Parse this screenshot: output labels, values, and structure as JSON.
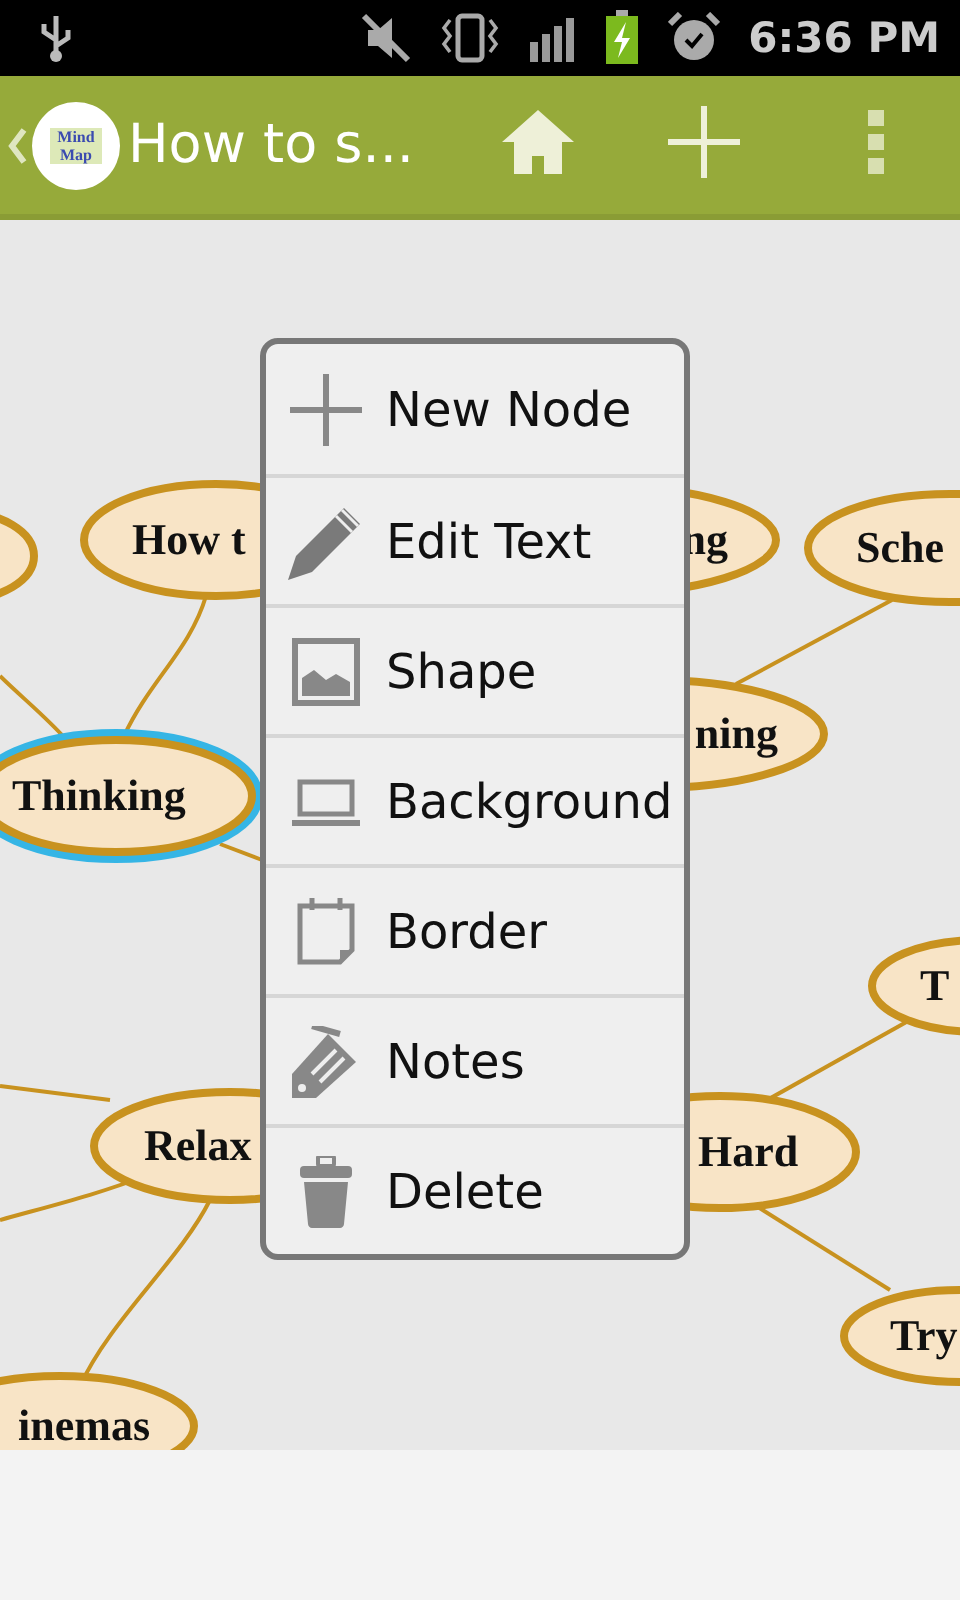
{
  "status_bar": {
    "time": "6:36 PM"
  },
  "action_bar": {
    "logo_text": "Mind Map",
    "title": "How to s..."
  },
  "mind_map": {
    "nodes": [
      {
        "text": "How t",
        "selected": false
      },
      {
        "text": "ng",
        "selected": false
      },
      {
        "text": "Sche",
        "selected": false
      },
      {
        "text": "ning",
        "selected": false
      },
      {
        "text": "Thinking",
        "selected": true
      },
      {
        "text": "T",
        "selected": false
      },
      {
        "text": "Relax",
        "selected": false
      },
      {
        "text": "Hard",
        "selected": false
      },
      {
        "text": "Try",
        "selected": false
      },
      {
        "text": "inemas",
        "selected": false
      }
    ]
  },
  "context_menu": {
    "items": [
      {
        "label": "New Node"
      },
      {
        "label": "Edit Text"
      },
      {
        "label": "Shape"
      },
      {
        "label": "Background"
      },
      {
        "label": "Border"
      },
      {
        "label": "Notes"
      },
      {
        "label": "Delete"
      }
    ]
  }
}
